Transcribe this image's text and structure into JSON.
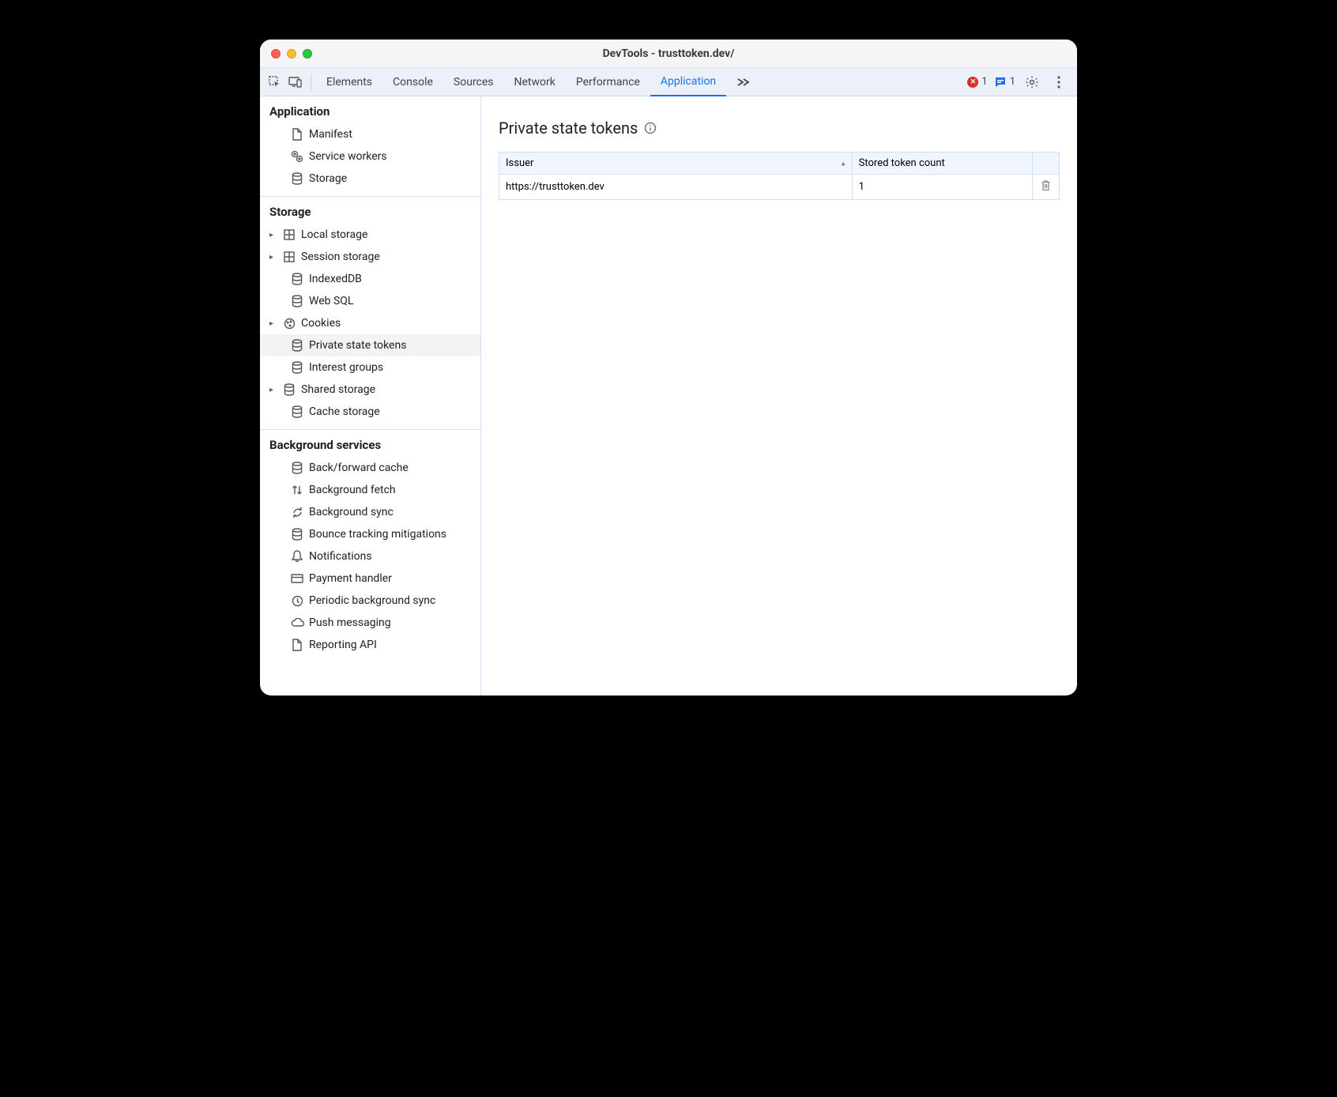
{
  "window": {
    "title": "DevTools - trusttoken.dev/"
  },
  "toolbar": {
    "tabs": [
      {
        "label": "Elements"
      },
      {
        "label": "Console"
      },
      {
        "label": "Sources"
      },
      {
        "label": "Network"
      },
      {
        "label": "Performance"
      },
      {
        "label": "Application",
        "active": true
      }
    ],
    "error_count": "1",
    "msg_count": "1"
  },
  "sidebar": {
    "sections": [
      {
        "title": "Application",
        "items": [
          {
            "label": "Manifest",
            "icon": "file"
          },
          {
            "label": "Service workers",
            "icon": "gears"
          },
          {
            "label": "Storage",
            "icon": "db"
          }
        ]
      },
      {
        "title": "Storage",
        "items": [
          {
            "label": "Local storage",
            "icon": "grid",
            "children": true
          },
          {
            "label": "Session storage",
            "icon": "grid",
            "children": true
          },
          {
            "label": "IndexedDB",
            "icon": "db"
          },
          {
            "label": "Web SQL",
            "icon": "db"
          },
          {
            "label": "Cookies",
            "icon": "cookie",
            "children": true
          },
          {
            "label": "Private state tokens",
            "icon": "db",
            "selected": true
          },
          {
            "label": "Interest groups",
            "icon": "db"
          },
          {
            "label": "Shared storage",
            "icon": "db",
            "children": true
          },
          {
            "label": "Cache storage",
            "icon": "db"
          }
        ]
      },
      {
        "title": "Background services",
        "items": [
          {
            "label": "Back/forward cache",
            "icon": "db"
          },
          {
            "label": "Background fetch",
            "icon": "updown"
          },
          {
            "label": "Background sync",
            "icon": "sync"
          },
          {
            "label": "Bounce tracking mitigations",
            "icon": "db"
          },
          {
            "label": "Notifications",
            "icon": "bell"
          },
          {
            "label": "Payment handler",
            "icon": "card"
          },
          {
            "label": "Periodic background sync",
            "icon": "clock"
          },
          {
            "label": "Push messaging",
            "icon": "cloud"
          },
          {
            "label": "Reporting API",
            "icon": "file"
          }
        ]
      }
    ]
  },
  "main": {
    "heading": "Private state tokens",
    "table": {
      "columns": [
        "Issuer",
        "Stored token count"
      ],
      "rows": [
        {
          "issuer": "https://trusttoken.dev",
          "count": "1"
        }
      ]
    }
  }
}
